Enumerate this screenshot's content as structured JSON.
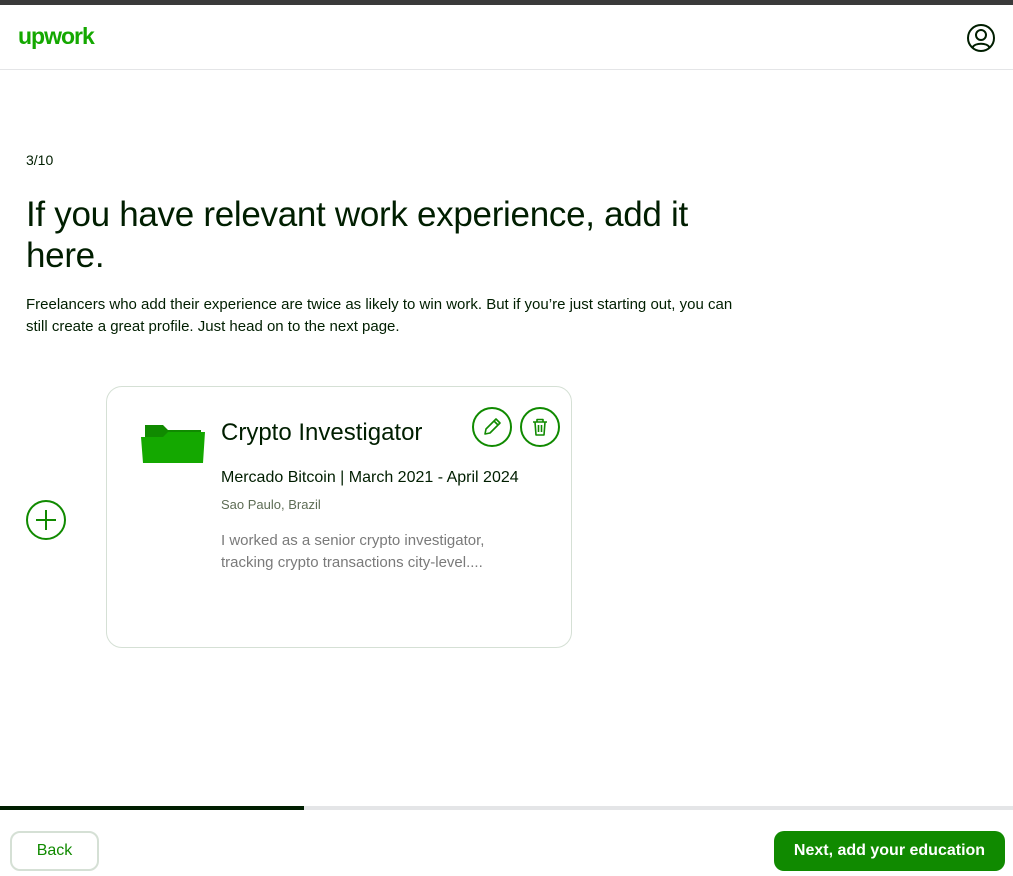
{
  "header": {
    "logo_text": "upwork",
    "user_icon": "user-circle-icon"
  },
  "main": {
    "step": "3/10",
    "title": "If you have relevant work experience, add it here.",
    "description": "Freelancers who add their experience are twice as likely to win work. But if you’re just starting out, you can still create a great profile. Just head on to the next page."
  },
  "experience_card": {
    "icon": "folder-icon",
    "job_title": "Crypto Investigator",
    "company_line": "Mercado Bitcoin | March 2021 - April 2024",
    "location": "Sao Paulo, Brazil",
    "summary": "I worked as a senior crypto investigator, tracking crypto transactions city-level....",
    "edit_icon": "pencil-icon",
    "delete_icon": "trash-icon"
  },
  "add_icon": "plus-icon",
  "progress": {
    "fraction": 0.3
  },
  "footer": {
    "back_label": "Back",
    "next_label": "Next, add your education"
  },
  "colors": {
    "brand_green": "#14a800",
    "button_green": "#108a00",
    "text_dark": "#001e00"
  }
}
